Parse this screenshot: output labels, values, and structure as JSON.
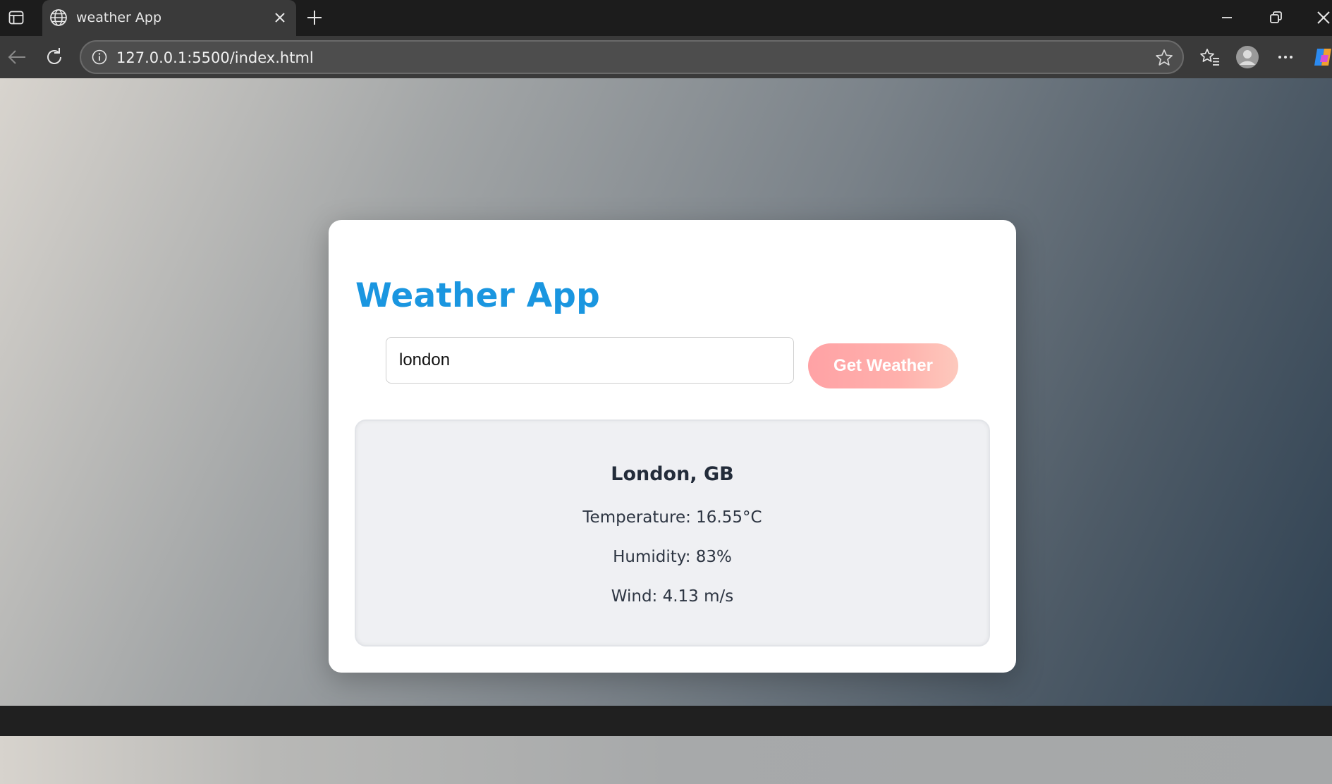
{
  "browser": {
    "tab_title": "weather App",
    "url": "127.0.0.1:5500/index.html"
  },
  "app": {
    "title": "Weather App",
    "search": {
      "value": "london",
      "button_label": "Get Weather"
    },
    "result": {
      "city": "London, GB",
      "temperature": "Temperature: 16.55°C",
      "humidity": "Humidity: 83%",
      "wind": "Wind: 4.13 m/s"
    }
  },
  "colors": {
    "title_blue": "#1a96e0",
    "button_gradient_start": "#ffa2a5",
    "button_gradient_end": "#fdc9bd"
  }
}
